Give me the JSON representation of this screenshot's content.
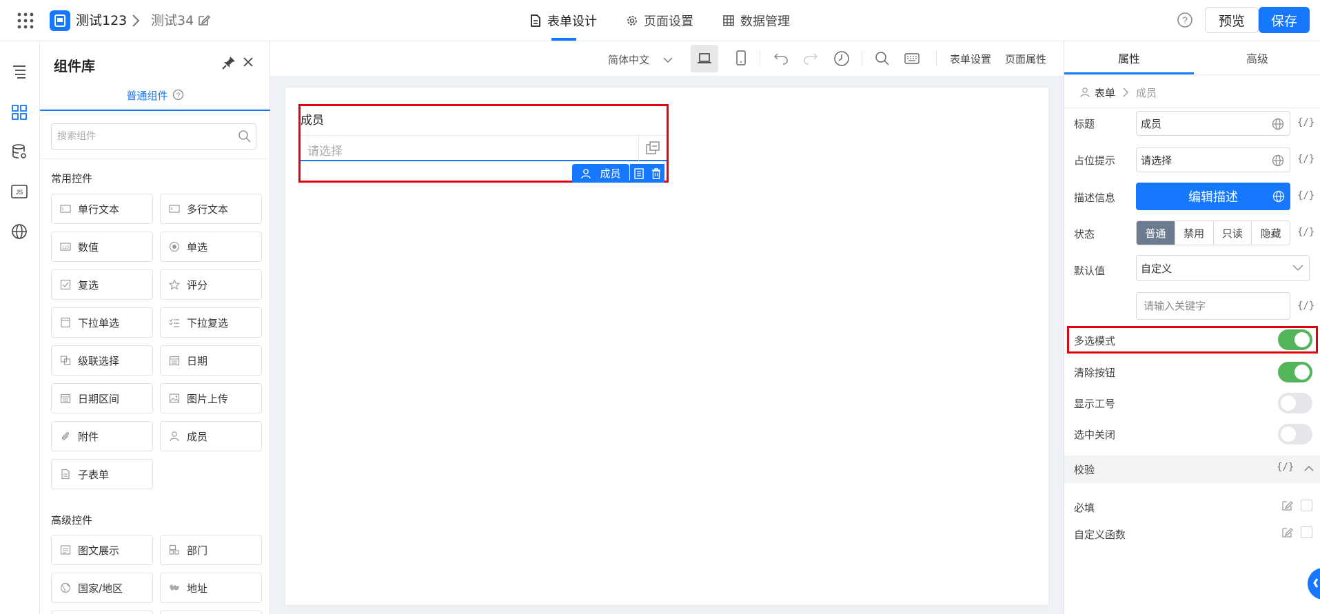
{
  "header": {
    "app_name": "测试123",
    "page_name": "测试34",
    "tabs": [
      {
        "label": "表单设计",
        "active": true
      },
      {
        "label": "页面设置",
        "active": false
      },
      {
        "label": "数据管理",
        "active": false
      }
    ],
    "preview_label": "预览",
    "save_label": "保存",
    "accent": "#1677ff"
  },
  "left_rail": {
    "icons": [
      "outline-icon",
      "components-icon",
      "datasource-icon",
      "js-icon",
      "globe-icon"
    ],
    "js_text": "JS"
  },
  "component_panel": {
    "title": "组件库",
    "tab": "普通组件",
    "search_placeholder": "搜索组件",
    "sections": [
      {
        "title": "常用控件",
        "items": [
          "单行文本",
          "多行文本",
          "数值",
          "单选",
          "复选",
          "评分",
          "下拉单选",
          "下拉复选",
          "级联选择",
          "日期",
          "日期区间",
          "图片上传",
          "附件",
          "成员",
          "子表单"
        ]
      },
      {
        "title": "高级控件",
        "items": [
          "图文展示",
          "部门",
          "国家/地区",
          "地址"
        ]
      }
    ]
  },
  "canvas_toolbar": {
    "language": "简体中文",
    "form_settings": "表单设置",
    "page_properties": "页面属性"
  },
  "canvas": {
    "field_label": "成员",
    "field_placeholder": "请选择",
    "tag_label": "成员"
  },
  "properties": {
    "tabs": [
      "属性",
      "高级"
    ],
    "breadcrumb": {
      "form": "表单",
      "current": "成员"
    },
    "var_symbol": "{/}",
    "fields": {
      "title_label": "标题",
      "title_value": "成员",
      "placeholder_label": "占位提示",
      "placeholder_value": "请选择",
      "description_label": "描述信息",
      "description_button": "编辑描述",
      "status_label": "状态",
      "status_options": [
        "普通",
        "禁用",
        "只读",
        "隐藏"
      ],
      "status_selected": "普通",
      "default_label": "默认值",
      "default_value": "自定义",
      "keyword_placeholder": "请输入关键字"
    },
    "toggles": [
      {
        "label": "多选模式",
        "on": true
      },
      {
        "label": "清除按钮",
        "on": true
      },
      {
        "label": "显示工号",
        "on": false
      },
      {
        "label": "选中关闭",
        "on": false
      }
    ],
    "validation": {
      "title": "校验",
      "items": [
        "必填",
        "自定义函数"
      ]
    }
  }
}
